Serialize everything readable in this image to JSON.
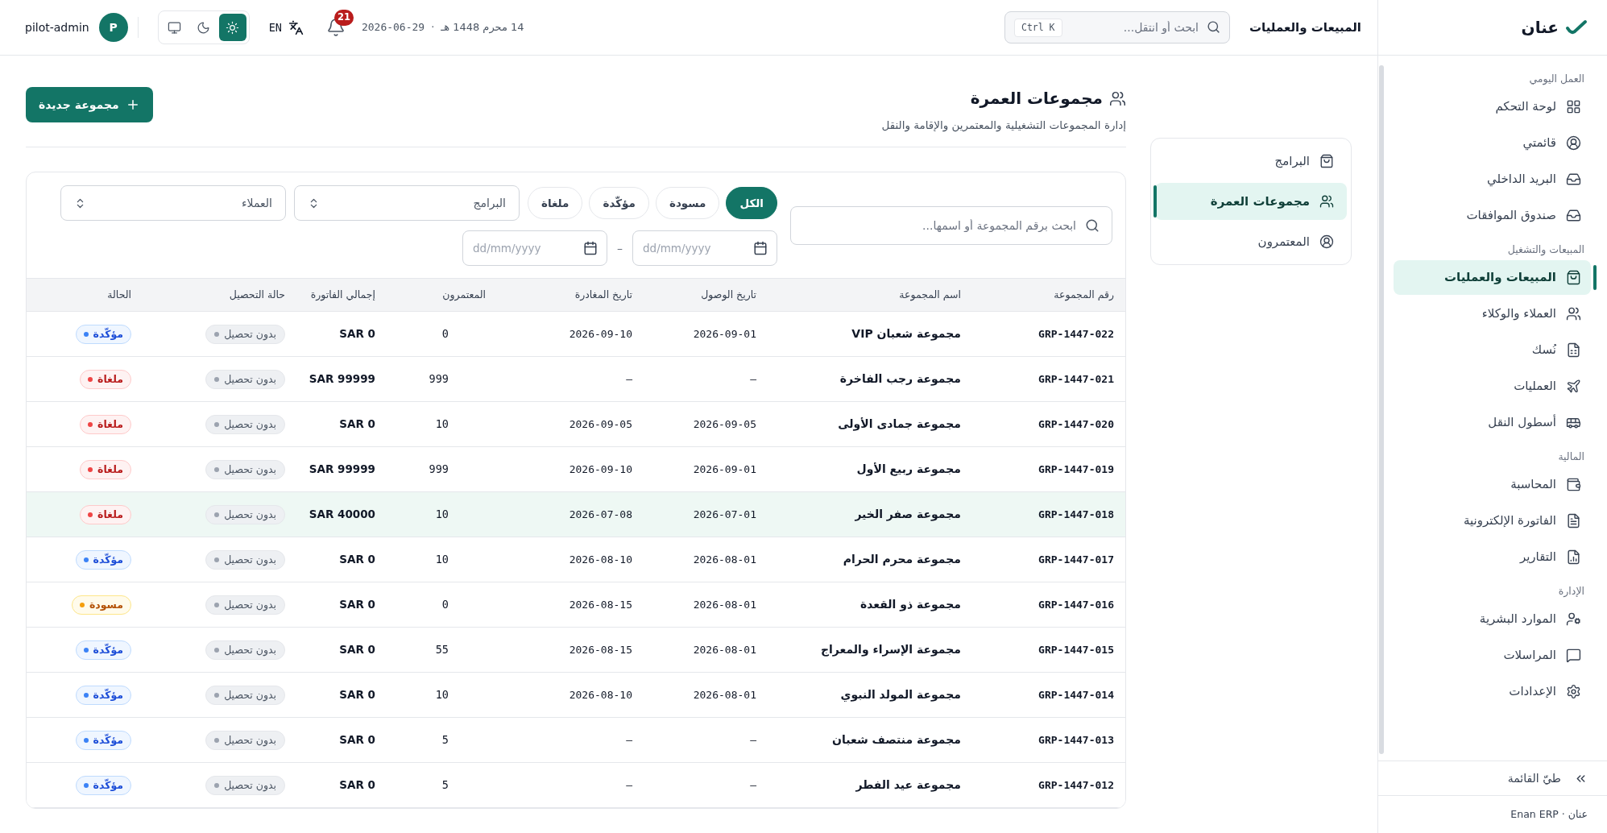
{
  "brand": {
    "name": "عنان"
  },
  "topbar": {
    "title": "المبيعات والعمليات",
    "search": {
      "placeholder": "ابحث أو انتقل...",
      "shortcut": "Ctrl K"
    },
    "hijri_date": "14 محرم 1448 هـ",
    "date_separator": "·",
    "gregorian_date": "2026-06-29",
    "notifications": "21",
    "language": "EN",
    "theme_options": [
      {
        "kind": "light",
        "selected": true
      },
      {
        "kind": "dark",
        "selected": false
      },
      {
        "kind": "system",
        "selected": false
      }
    ],
    "user": {
      "initial": "P",
      "name": "pilot-admin"
    }
  },
  "sidebar": {
    "sections": [
      {
        "title": "العمل اليومي",
        "items": [
          {
            "label": "لوحة التحكم",
            "selected": false
          },
          {
            "label": "قائمتي",
            "selected": false
          },
          {
            "label": "البريد الداخلي",
            "selected": false
          },
          {
            "label": "صندوق الموافقات",
            "selected": false
          }
        ]
      },
      {
        "title": "المبيعات والتشغيل",
        "items": [
          {
            "label": "المبيعات والعمليات",
            "selected": true
          },
          {
            "label": "العملاء والوكلاء",
            "selected": false
          },
          {
            "label": "نُسك",
            "selected": false
          },
          {
            "label": "العمليات",
            "selected": false
          },
          {
            "label": "أسطول النقل",
            "selected": false
          }
        ]
      },
      {
        "title": "المالية",
        "items": [
          {
            "label": "المحاسبة",
            "selected": false
          },
          {
            "label": "الفاتورة الإلكترونية",
            "selected": false
          },
          {
            "label": "التقارير",
            "selected": false
          }
        ]
      },
      {
        "title": "الإدارة",
        "items": [
          {
            "label": "الموارد البشرية",
            "selected": false
          },
          {
            "label": "المراسلات",
            "selected": false
          },
          {
            "label": "الإعدادات",
            "selected": false
          }
        ]
      }
    ],
    "collapse": "طيّ القائمة",
    "footer": "عنان · Enan ERP"
  },
  "subnav": [
    {
      "label": "البرامج",
      "selected": false
    },
    {
      "label": "مجموعات العمرة",
      "selected": true
    },
    {
      "label": "المعتمرون",
      "selected": false
    }
  ],
  "page": {
    "title": "مجموعات العمرة",
    "subtitle": "إدارة المجموعات التشغيلية والمعتمرين والإقامة والنقل",
    "new_button": "مجموعة جديدة"
  },
  "filters": {
    "search": {
      "placeholder": "ابحث برقم المجموعة أو اسمها..."
    },
    "status_chips": [
      {
        "label": "الكل",
        "selected": true
      },
      {
        "label": "مسودة",
        "selected": false
      },
      {
        "label": "مؤكّدة",
        "selected": false
      },
      {
        "label": "ملغاة",
        "selected": false
      }
    ],
    "selects": [
      {
        "value": "البرامج"
      },
      {
        "value": "العملاء"
      }
    ],
    "date_from": {
      "placeholder": "dd/mm/yyyy"
    },
    "date_separator": "–",
    "date_to": {
      "placeholder": "dd/mm/yyyy"
    }
  },
  "table": {
    "columns": [
      "رقم المجموعة",
      "اسم المجموعة",
      "تاريخ الوصول",
      "تاريخ المغادرة",
      "المعتمرون",
      "إجمالي الفاتورة",
      "حالة التحصيل",
      "الحالة"
    ],
    "rows": [
      {
        "code": "GRP-1447-022",
        "name": "مجموعة شعبان VIP",
        "arrival": "2026-09-01",
        "departure": "2026-09-10",
        "pilgrims": "0",
        "invoice": "SAR 0",
        "collection": "بدون تحصيل",
        "status": "مؤكّدة",
        "kind": "confirmed",
        "selected": false
      },
      {
        "code": "GRP-1447-021",
        "name": "مجموعة رجب الفاخرة",
        "arrival": "–",
        "departure": "–",
        "pilgrims": "999",
        "invoice": "SAR 99999",
        "collection": "بدون تحصيل",
        "status": "ملغاة",
        "kind": "cancelled",
        "selected": false
      },
      {
        "code": "GRP-1447-020",
        "name": "مجموعة جمادى الأولى",
        "arrival": "2026-09-05",
        "departure": "2026-09-05",
        "pilgrims": "10",
        "invoice": "SAR 0",
        "collection": "بدون تحصيل",
        "status": "ملغاة",
        "kind": "cancelled",
        "selected": false
      },
      {
        "code": "GRP-1447-019",
        "name": "مجموعة ربيع الأول",
        "arrival": "2026-09-01",
        "departure": "2026-09-10",
        "pilgrims": "999",
        "invoice": "SAR 99999",
        "collection": "بدون تحصيل",
        "status": "ملغاة",
        "kind": "cancelled",
        "selected": false
      },
      {
        "code": "GRP-1447-018",
        "name": "مجموعة صفر الخير",
        "arrival": "2026-07-01",
        "departure": "2026-07-08",
        "pilgrims": "10",
        "invoice": "SAR 40000",
        "collection": "بدون تحصيل",
        "status": "ملغاة",
        "kind": "cancelled",
        "selected": true
      },
      {
        "code": "GRP-1447-017",
        "name": "مجموعة محرم الحرام",
        "arrival": "2026-08-01",
        "departure": "2026-08-10",
        "pilgrims": "10",
        "invoice": "SAR 0",
        "collection": "بدون تحصيل",
        "status": "مؤكّدة",
        "kind": "confirmed",
        "selected": false
      },
      {
        "code": "GRP-1447-016",
        "name": "مجموعة ذو القعدة",
        "arrival": "2026-08-01",
        "departure": "2026-08-15",
        "pilgrims": "0",
        "invoice": "SAR 0",
        "collection": "بدون تحصيل",
        "status": "مسودة",
        "kind": "draft",
        "selected": false
      },
      {
        "code": "GRP-1447-015",
        "name": "مجموعة الإسراء والمعراج",
        "arrival": "2026-08-01",
        "departure": "2026-08-15",
        "pilgrims": "55",
        "invoice": "SAR 0",
        "collection": "بدون تحصيل",
        "status": "مؤكّدة",
        "kind": "confirmed",
        "selected": false
      },
      {
        "code": "GRP-1447-014",
        "name": "مجموعة المولد النبوي",
        "arrival": "2026-08-01",
        "departure": "2026-08-10",
        "pilgrims": "10",
        "invoice": "SAR 0",
        "collection": "بدون تحصيل",
        "status": "مؤكّدة",
        "kind": "confirmed",
        "selected": false
      },
      {
        "code": "GRP-1447-013",
        "name": "مجموعة منتصف شعبان",
        "arrival": "–",
        "departure": "–",
        "pilgrims": "5",
        "invoice": "SAR 0",
        "collection": "بدون تحصيل",
        "status": "مؤكّدة",
        "kind": "confirmed",
        "selected": false
      },
      {
        "code": "GRP-1447-012",
        "name": "مجموعة عيد الفطر",
        "arrival": "–",
        "departure": "–",
        "pilgrims": "5",
        "invoice": "SAR 0",
        "collection": "بدون تحصيل",
        "status": "مؤكّدة",
        "kind": "confirmed",
        "selected": false
      }
    ]
  }
}
